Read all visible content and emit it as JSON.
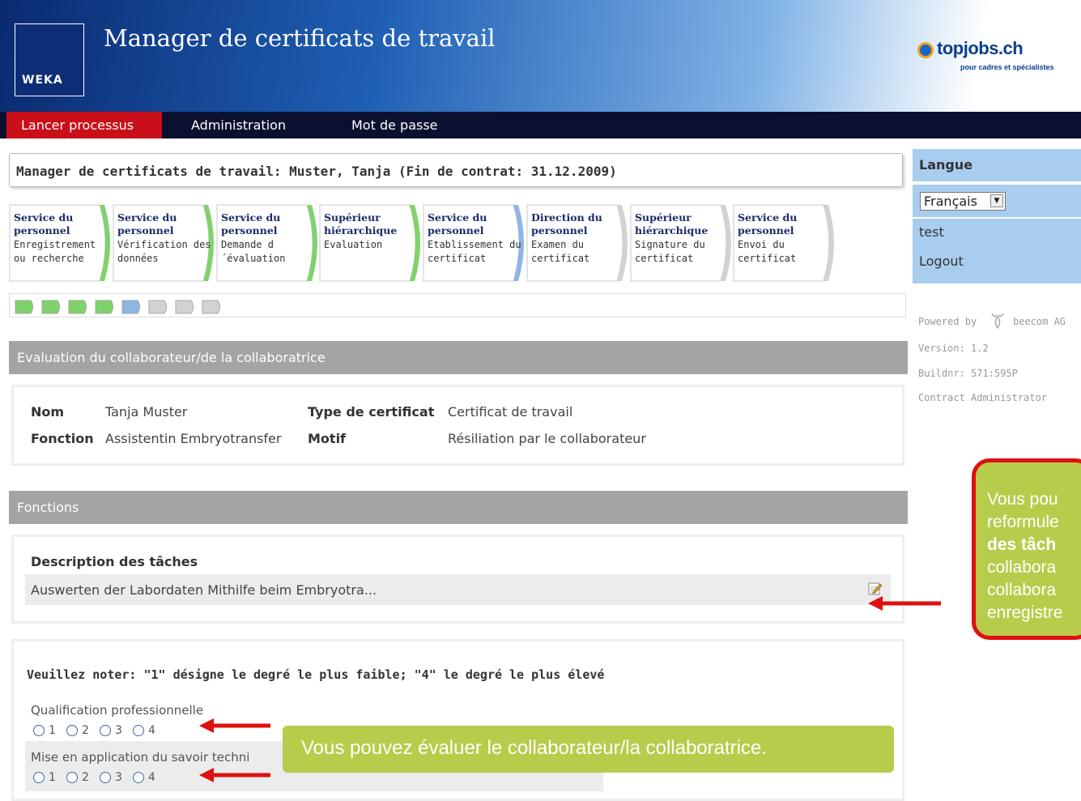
{
  "header": {
    "logo": "WEKA",
    "title": "Manager de certificats de travail",
    "brand": "topjobs.ch",
    "brand_sub": "pour cadres et spécialistes"
  },
  "nav": {
    "items": [
      "Lancer processus",
      "Administration",
      "Mot de passe"
    ]
  },
  "page_title": "Manager de certificats de travail: Muster, Tanja (Fin de contrat: 31.12.2009)",
  "steps": [
    {
      "title": "Service du personnel",
      "desc": "Enregistrement ou recherche",
      "status": "done"
    },
    {
      "title": "Service du personnel",
      "desc": "Vérification des données",
      "status": "done"
    },
    {
      "title": "Service du personnel",
      "desc": "Demande d´évaluation",
      "status": "done"
    },
    {
      "title": "Supérieur hiérarchique",
      "desc": "Evaluation",
      "status": "done"
    },
    {
      "title": "Service du personnel",
      "desc": "Etablissement du certificat",
      "status": "current"
    },
    {
      "title": "Direction du personnel",
      "desc": "Examen du certificat",
      "status": "pending"
    },
    {
      "title": "Supérieur hiérarchique",
      "desc": "Signature du certificat",
      "status": "pending"
    },
    {
      "title": "Service du personnel",
      "desc": "Envoi du certificat",
      "status": "pending"
    }
  ],
  "colors": {
    "done": "#7fd36a",
    "current": "#8fb5e4",
    "pending": "#d2d2d2"
  },
  "evaluation": {
    "header": "Evaluation du collaborateur/de la collaboratrice",
    "nom_label": "Nom",
    "nom_value": "Tanja Muster",
    "fonction_label": "Fonction",
    "fonction_value": "Assistentin Embryotransfer",
    "type_label": "Type de certificat",
    "type_value": "Certificat de travail",
    "motif_label": "Motif",
    "motif_value": "Résiliation par le collaborateur"
  },
  "fonctions": {
    "header": "Fonctions",
    "desc_label": "Description des tâches",
    "desc_value": "Auswerten der Labordaten Mithilfe beim Embryotra..."
  },
  "rating": {
    "note": "Veuillez noter: \"1\" désigne le degré le plus faible; \"4\" le degré le plus élevé",
    "items": [
      {
        "label": "Qualification professionnelle"
      },
      {
        "label": "Mise en application du savoir techni"
      }
    ],
    "options": [
      "1",
      "2",
      "3",
      "4"
    ]
  },
  "sidebar": {
    "langue_label": "Langue",
    "langue_value": "Français",
    "user": "test",
    "logout": "Logout",
    "powered_by": "Powered by",
    "company": "beecom AG",
    "version": "Version: 1.2",
    "build": "Buildnr: 571:595P",
    "contract": "Contract Administrator"
  },
  "callouts": {
    "c1_lines": [
      "Vous pou",
      "reformule",
      "des tâch",
      "collabora",
      "collabora",
      "enregistre"
    ],
    "c2": "Vous pouvez évaluer le collaborateur/la collaboratrice."
  }
}
